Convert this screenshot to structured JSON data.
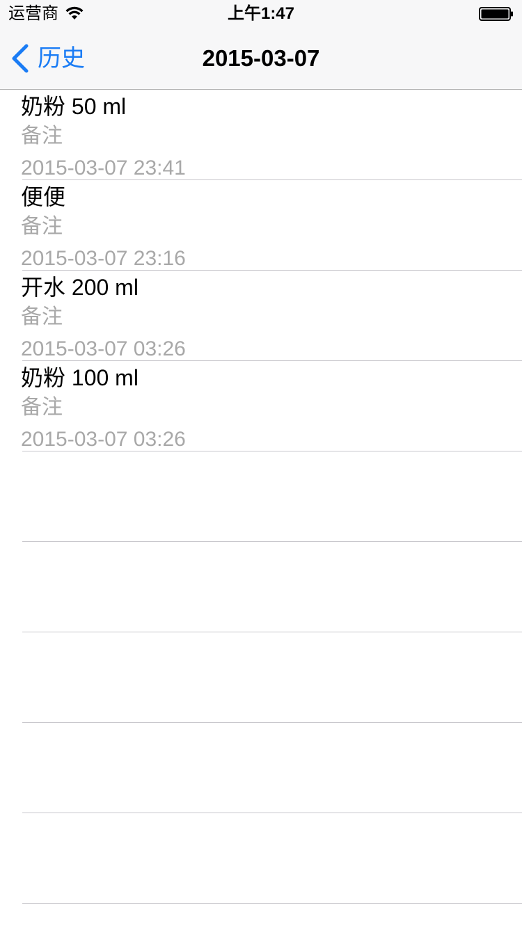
{
  "status_bar": {
    "carrier": "运营商",
    "time": "上午1:47",
    "icons": [
      "wifi-icon",
      "battery-icon"
    ]
  },
  "nav": {
    "back_label": "历史",
    "back_icon": "chevron-left-icon",
    "title": "2015-03-07",
    "accent_color": "#1a7cf5"
  },
  "records": [
    {
      "title": "奶粉 50 ml",
      "note": "备注",
      "time": "2015-03-07 23:41"
    },
    {
      "title": "便便",
      "note": "备注",
      "time": "2015-03-07 23:16"
    },
    {
      "title": "开水 200 ml",
      "note": "备注",
      "time": "2015-03-07 03:26"
    },
    {
      "title": "奶粉 100 ml",
      "note": "备注",
      "time": "2015-03-07 03:26"
    }
  ]
}
